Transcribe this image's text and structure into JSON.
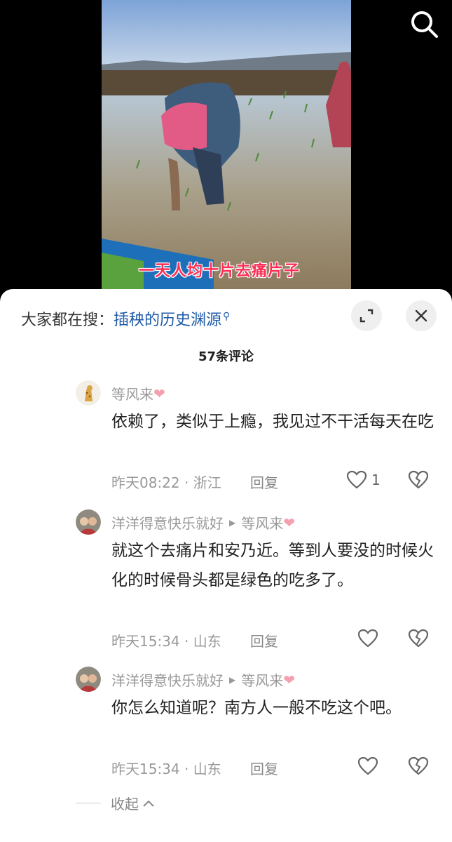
{
  "video": {
    "caption": "一天人均十片去痛片子"
  },
  "search_icon": "search-icon",
  "sheet": {
    "suggest_prefix": "大家都在搜：",
    "suggest_keyword": "插秧的历史渊源",
    "comment_count": "57条评论"
  },
  "comments": [
    {
      "user": "等风来",
      "heart": "❤",
      "text": "依赖了，类似于上瘾，我见过不干活每天在吃",
      "meta": "昨天08:22 · 浙江",
      "reply_label": "回复",
      "likes": "1"
    },
    {
      "user": "洋洋得意快乐就好",
      "reply_to": "等风来",
      "heart": "❤",
      "text": "就这个去痛片和安乃近。等到人要没的时候火化的时候骨头都是绿色的吃多了。",
      "meta": "昨天15:34 · 山东",
      "reply_label": "回复"
    },
    {
      "user": "洋洋得意快乐就好",
      "reply_to": "等风来",
      "heart": "❤",
      "text": "你怎么知道呢？南方人一般不吃这个吧。",
      "meta": "昨天15:34 · 山东",
      "reply_label": "回复"
    }
  ],
  "collapse_label": "收起",
  "colors": {
    "keyword": "#1f5aa8",
    "caption": "#ff2d55",
    "heart": "#f4a0b0"
  }
}
